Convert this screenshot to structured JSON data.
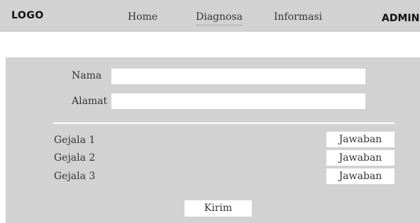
{
  "header": {
    "logo": "LOGO",
    "nav": {
      "home": "Home",
      "diagnosa": "Diagnosa",
      "informasi": "Informasi"
    },
    "admin": "ADMIN"
  },
  "form": {
    "nama_label": "Nama",
    "nama_value": "",
    "alamat_label": "Alamat",
    "alamat_value": "",
    "gejala": [
      {
        "label": "Gejala 1",
        "button": "Jawaban"
      },
      {
        "label": "Gejala 2",
        "button": "Jawaban"
      },
      {
        "label": "Gejala 3",
        "button": "Jawaban"
      }
    ],
    "submit_label": "Kirim"
  },
  "colors": {
    "bar_background": "#d2d2d2",
    "field_background": "#ffffff",
    "text": "#333333"
  }
}
